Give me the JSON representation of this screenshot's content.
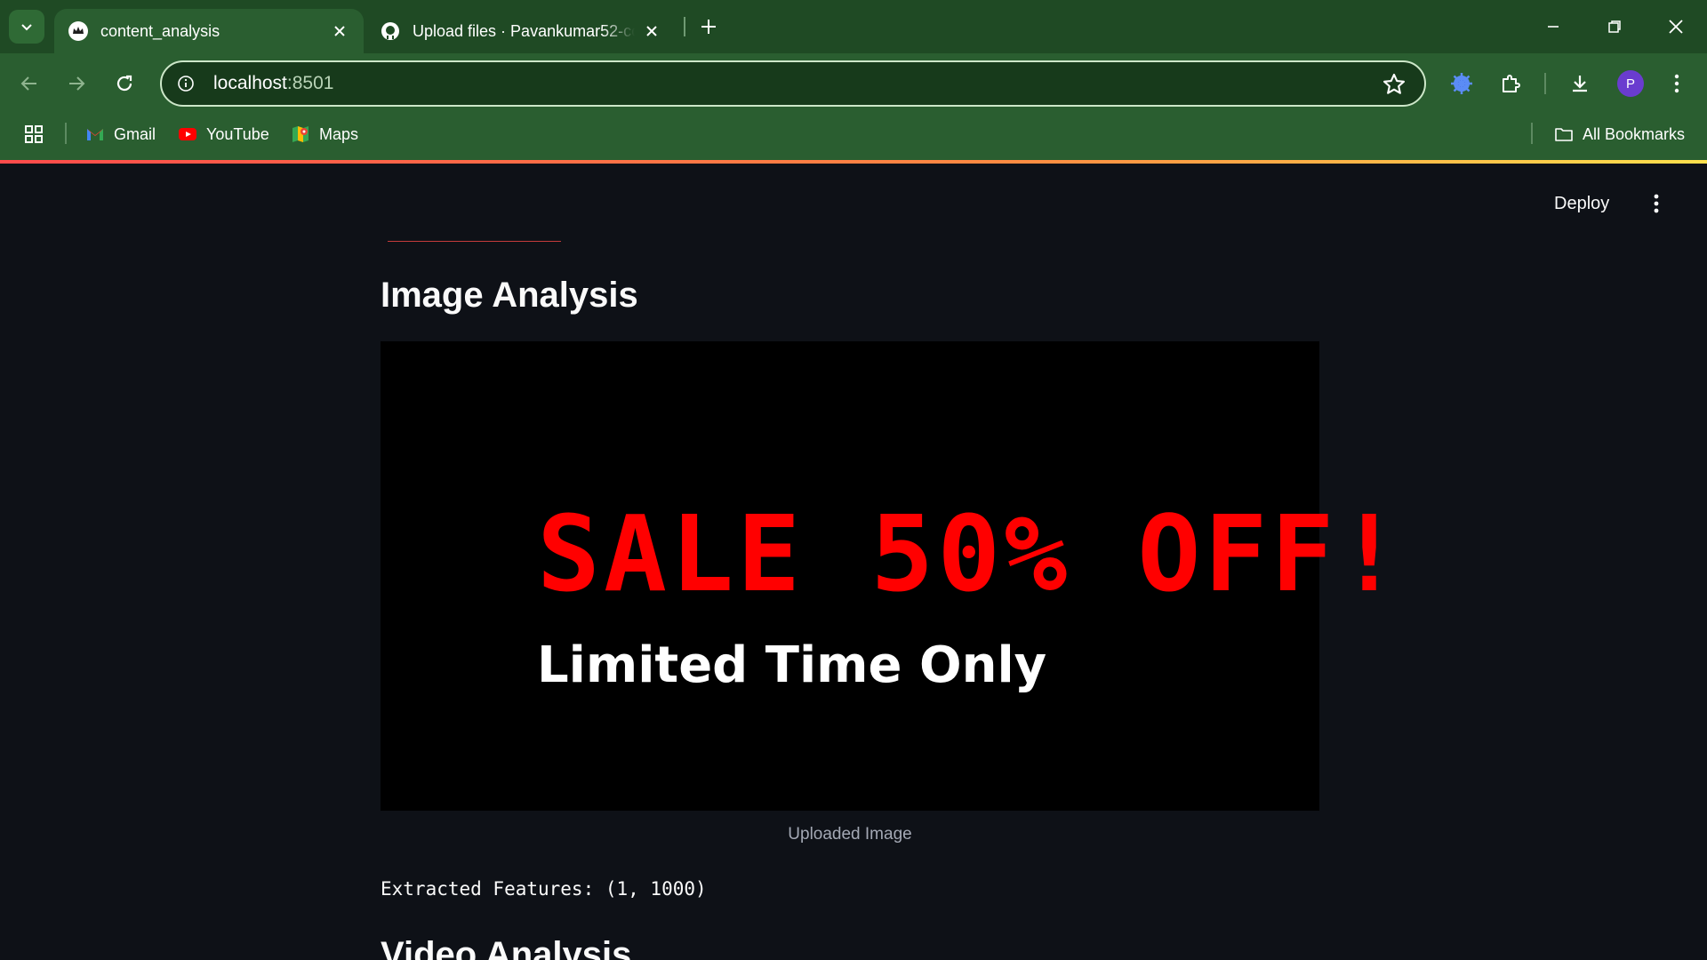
{
  "browser": {
    "tabs": [
      {
        "title": "content_analysis",
        "active": true,
        "favicon": "streamlit-crown-icon"
      },
      {
        "title": "Upload files · Pavankumar52-co",
        "active": false,
        "favicon": "github-icon"
      }
    ],
    "address": {
      "host": "localhost",
      "port": ":8501"
    },
    "bookmarks": [
      {
        "label": "Gmail",
        "icon": "gmail-icon"
      },
      {
        "label": "YouTube",
        "icon": "youtube-icon"
      },
      {
        "label": "Maps",
        "icon": "maps-icon"
      }
    ],
    "all_bookmarks_label": "All Bookmarks",
    "profile_initial": "P"
  },
  "app": {
    "deploy_label": "Deploy",
    "image_section_title": "Image Analysis",
    "image": {
      "headline": "SALE 50% OFF!",
      "subline": "Limited Time Only"
    },
    "image_caption": "Uploaded Image",
    "features_text": "Extracted Features: (1, 1000)",
    "video_section_title": "Video Analysis"
  },
  "colors": {
    "chrome_bg": "#2a5e30",
    "app_bg": "#0e1117",
    "sale_red": "#ff0000"
  }
}
